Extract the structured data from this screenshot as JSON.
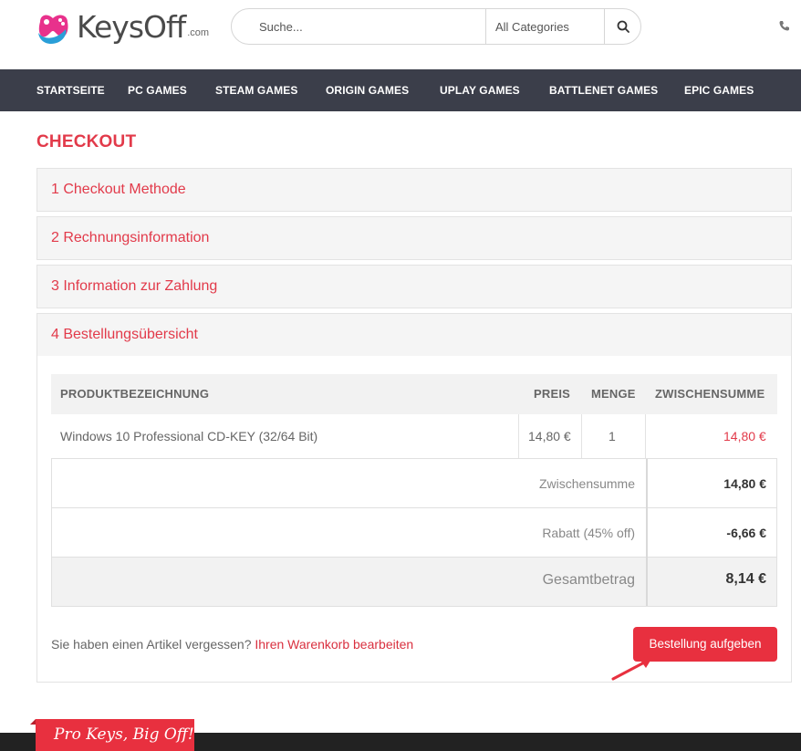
{
  "brand": {
    "name": "KeysOff",
    "suffix": ".com"
  },
  "search": {
    "placeholder": "Suche...",
    "category": "All Categories"
  },
  "nav": [
    "STARTSEITE",
    "PC GAMES",
    "STEAM GAMES",
    "ORIGIN GAMES",
    "UPLAY GAMES",
    "BATTLENET GAMES",
    "EPIC GAMES"
  ],
  "page_title": "CHECKOUT",
  "steps": [
    "1 Checkout Methode",
    "2 Rechnungsinformation",
    "3 Information zur Zahlung",
    "4 Bestellungsübersicht"
  ],
  "table": {
    "headers": [
      "PRODUKTBEZEICHNUNG",
      "PREIS",
      "MENGE",
      "ZWISCHENSUMME"
    ],
    "rows": [
      {
        "product": "Windows 10 Professional CD-KEY (32/64 Bit)",
        "price": "14,80 €",
        "qty": "1",
        "subtotal": "14,80 €"
      }
    ]
  },
  "totals": [
    {
      "label": "Zwischensumme",
      "value": "14,80 €"
    },
    {
      "label": "Rabatt (45% off)",
      "value": "-6,66 €"
    },
    {
      "label": "Gesamtbetrag",
      "value": "8,14 €"
    }
  ],
  "footer": {
    "note": "Sie haben einen Artikel vergessen?",
    "link": "Ihren Warenkorb bearbeiten",
    "button": "Bestellung aufgeben"
  },
  "tagline": "Pro Keys, Big Off!",
  "colors": {
    "accent": "#e23a4a",
    "nav_bg": "#3b3e4a",
    "button": "#e8303f"
  }
}
